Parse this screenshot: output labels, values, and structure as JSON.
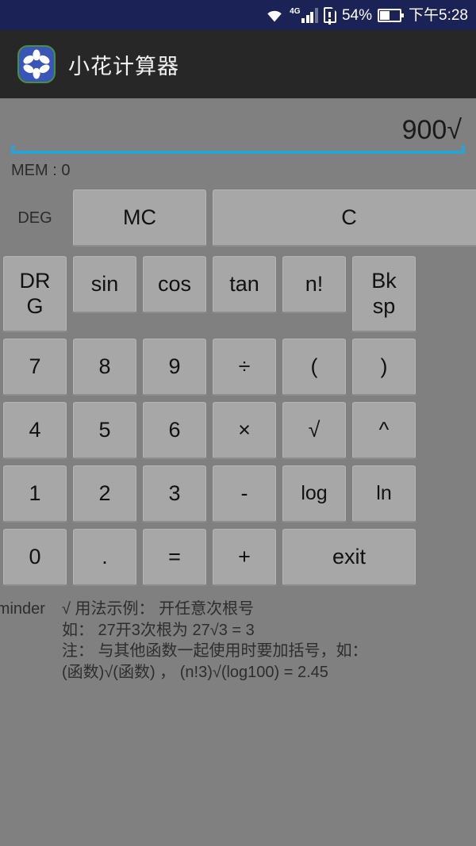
{
  "status_bar": {
    "wifi_icon": "wifi-icon",
    "network_label": "4G",
    "signal_icon": "signal-bars-icon",
    "sim_icon": "sim-card-icon",
    "battery_percent": "54%",
    "battery_icon": "battery-icon",
    "time": "下午5:28",
    "background_color": "#1b2255"
  },
  "app_bar": {
    "icon": "flower-app-icon",
    "title": "小花计算器",
    "background_color": "#272727"
  },
  "display": {
    "value": "900√",
    "underline_color": "#29a3cf",
    "memory_label": "MEM : 0",
    "angle_mode": "DEG"
  },
  "keypad": {
    "rows": [
      [
        {
          "label": "MC",
          "name": "memory-clear-button"
        },
        {
          "label": "C",
          "name": "clear-button"
        }
      ],
      [
        {
          "label": "DR\nG",
          "name": "drg-button"
        },
        {
          "label": "sin",
          "name": "sin-button"
        },
        {
          "label": "cos",
          "name": "cos-button"
        },
        {
          "label": "tan",
          "name": "tan-button"
        },
        {
          "label": "n!",
          "name": "factorial-button"
        },
        {
          "label": "Bk\nsp",
          "name": "backspace-button"
        }
      ],
      [
        {
          "label": "7",
          "name": "digit-7-button"
        },
        {
          "label": "8",
          "name": "digit-8-button"
        },
        {
          "label": "9",
          "name": "digit-9-button"
        },
        {
          "label": "÷",
          "name": "divide-button"
        },
        {
          "label": "(",
          "name": "open-paren-button"
        },
        {
          "label": ")",
          "name": "close-paren-button"
        }
      ],
      [
        {
          "label": "4",
          "name": "digit-4-button"
        },
        {
          "label": "5",
          "name": "digit-5-button"
        },
        {
          "label": "6",
          "name": "digit-6-button"
        },
        {
          "label": "×",
          "name": "multiply-button"
        },
        {
          "label": "√",
          "name": "sqrt-button"
        },
        {
          "label": "^",
          "name": "power-button"
        }
      ],
      [
        {
          "label": "1",
          "name": "digit-1-button"
        },
        {
          "label": "2",
          "name": "digit-2-button"
        },
        {
          "label": "3",
          "name": "digit-3-button"
        },
        {
          "label": "-",
          "name": "minus-button"
        },
        {
          "label": "log",
          "name": "log-button"
        },
        {
          "label": "ln",
          "name": "ln-button"
        }
      ],
      [
        {
          "label": "0",
          "name": "digit-0-button"
        },
        {
          "label": ".",
          "name": "decimal-point-button"
        },
        {
          "label": "=",
          "name": "equals-button"
        },
        {
          "label": "+",
          "name": "plus-button"
        },
        {
          "label": "exit",
          "name": "exit-button"
        }
      ]
    ]
  },
  "reminder": {
    "label_line1": "reminder",
    "label_line2": ":",
    "lines": [
      "√ 用法示例： 开任意次根号",
      "如： 27开3次根为  27√3 = 3",
      "注： 与其他函数一起使用时要加括号，如：",
      "(函数)√(函数) ，  (n!3)√(log100) = 2.45"
    ]
  },
  "colors": {
    "background": "#808080",
    "button_face": "#a7a7a7",
    "accent": "#29a3cf"
  }
}
